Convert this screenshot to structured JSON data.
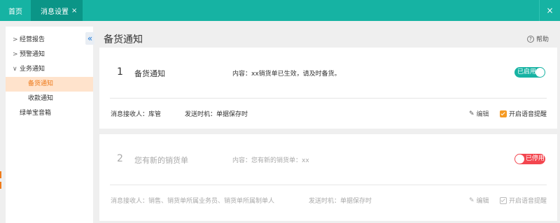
{
  "tabs": {
    "home_label": "首页",
    "active_label": "消息设置",
    "tab_close_glyph": "×",
    "window_close_glyph": "×"
  },
  "sidebar": {
    "collapse_glyph": "«",
    "items": [
      {
        "label": "经营报告",
        "arrow": ">"
      },
      {
        "label": "预警通知",
        "arrow": ">"
      },
      {
        "label": "业务通知",
        "arrow": "∨"
      },
      {
        "label": "备货通知"
      },
      {
        "label": "收款通知"
      },
      {
        "label": "绿单宝音箱"
      }
    ]
  },
  "page": {
    "title": "备货通知",
    "help_label": "帮助",
    "help_glyph": "?"
  },
  "cards": [
    {
      "index": "1",
      "name": "备货通知",
      "content": "内容：xx销货单已生效，请及时备货。",
      "status": "已启用",
      "receivers": "消息接收人：库管",
      "send_time": "发送时机：单据保存时",
      "edit_label": "编辑",
      "voice_label": "开启语音提醒"
    },
    {
      "index": "2",
      "name": "您有新的销货单",
      "content": "内容：您有新的销货单：xx",
      "status": "已停用",
      "receivers": "消息接收人：销售、销货单所属业务员、销货单所属制单人",
      "send_time": "发送时机：单据保存时",
      "edit_label": "编辑",
      "voice_label": "开启语音提醒"
    }
  ],
  "colors": {
    "accent": "#16b3a3",
    "accent_dark": "#0b9587",
    "active_menu_bg": "#ffe3cc",
    "active_menu_text": "#ee7a1a",
    "toggle_off": "#f3464f",
    "checkbox": "#f59a23"
  }
}
